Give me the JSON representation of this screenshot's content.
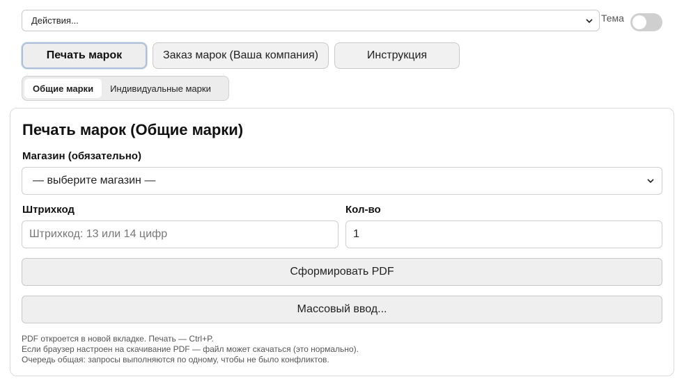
{
  "top": {
    "actions_select": "Действия...",
    "theme_label": "Тема"
  },
  "tabs": [
    {
      "label": "Печать марок"
    },
    {
      "label": "Заказ марок (Ваша компания)"
    },
    {
      "label": "Инструкция"
    }
  ],
  "segments": [
    {
      "label": "Общие марки"
    },
    {
      "label": "Индивидуальные марки"
    }
  ],
  "card": {
    "title": "Печать марок (Общие марки)",
    "store_label": "Магазин (обязательно)",
    "store_selected": "— выберите магазин —",
    "barcode_label": "Штрихкод",
    "barcode_placeholder": "Штрихкод: 13 или 14 цифр",
    "qty_label": "Кол-во",
    "qty_value": "1",
    "generate_pdf": "Сформировать PDF",
    "mass_input": "Массовый ввод...",
    "notes": [
      "PDF откроется в новой вкладке. Печать — Ctrl+P.",
      "Если браузер настроен на скачивание PDF — файл может скачаться (это нормально).",
      "Очередь общая: запросы выполняются по одному, чтобы не было конфликтов."
    ]
  },
  "icons": {
    "dropdown": "chevron-down-icon"
  }
}
